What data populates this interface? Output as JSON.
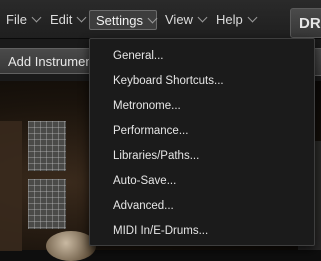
{
  "menubar": {
    "file": "File",
    "edit": "Edit",
    "settings": "Settings",
    "view": "View",
    "help": "Help",
    "brand_text": "DR"
  },
  "toolbar": {
    "add_instrument_label": "Add Instrument"
  },
  "settings_menu": {
    "items": [
      "General...",
      "Keyboard Shortcuts...",
      "Metronome...",
      "Performance...",
      "Libraries/Paths...",
      "Auto-Save...",
      "Advanced...",
      "MIDI In/E-Drums..."
    ]
  },
  "colors": {
    "menu_bg": "#1b1b1b",
    "menubar_bg": "#262626",
    "text": "#e6e6e6",
    "active_menu_bg": "#3d3d3d"
  },
  "icons": {
    "menu_chevron": "chevron-down-icon"
  }
}
